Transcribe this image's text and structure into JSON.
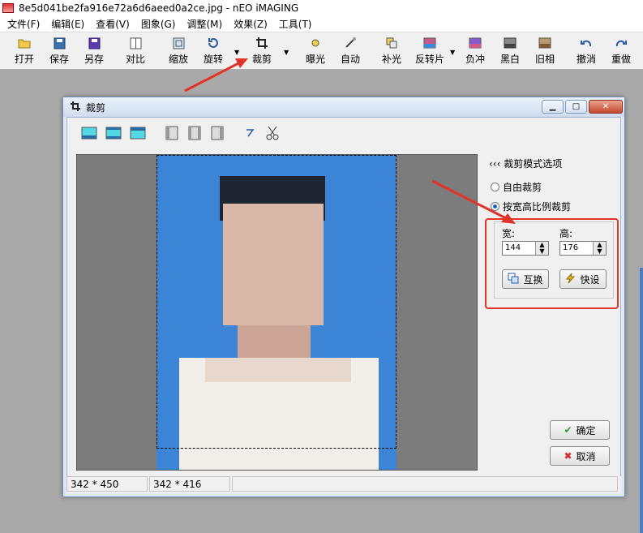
{
  "window": {
    "title": "8e5d041be2fa916e72a6d6aeed0a2ce.jpg - nEO iMAGING"
  },
  "menu": [
    {
      "label": "文件(F)"
    },
    {
      "label": "编辑(E)"
    },
    {
      "label": "查看(V)"
    },
    {
      "label": "图象(G)"
    },
    {
      "label": "调整(M)"
    },
    {
      "label": "效果(Z)"
    },
    {
      "label": "工具(T)"
    }
  ],
  "toolbar": {
    "open": "打开",
    "save": "保存",
    "save_as": "另存",
    "compare": "对比",
    "zoom": "缩放",
    "rotate": "旋转",
    "crop": "裁剪",
    "exposure": "曝光",
    "auto": "自动",
    "fill_light": "补光",
    "negative": "反转片",
    "fast_dev": "负冲",
    "bw": "黑白",
    "sepia": "旧相",
    "undo": "撤消",
    "redo": "重做"
  },
  "dialog": {
    "title": "裁剪",
    "options_title": "裁剪模式选项",
    "free_crop": "自由裁剪",
    "ratio_crop": "按宽高比例裁剪",
    "width_label": "宽:",
    "height_label": "高:",
    "width_value": "144",
    "height_value": "176",
    "swap_label": "互换",
    "preset_label": "快设",
    "ok_label": "确定",
    "cancel_label": "取消",
    "status_original": "342 * 450",
    "status_crop": "342 * 416",
    "selected_mode": "ratio"
  },
  "colors": {
    "accent": "#e0332a",
    "photo_bg": "#3b84d6"
  }
}
